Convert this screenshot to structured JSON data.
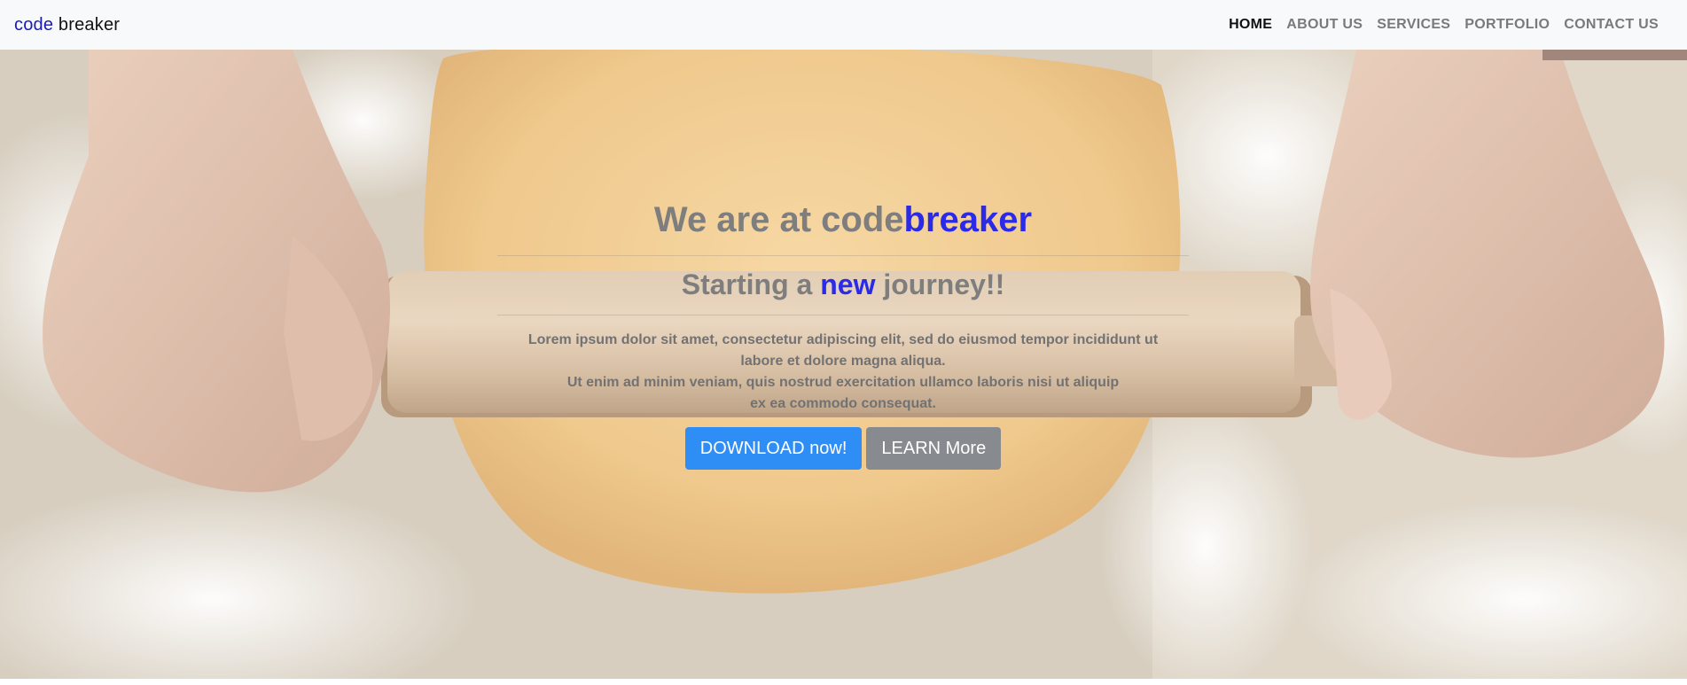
{
  "brand": {
    "part1": "code",
    "part2": " breaker"
  },
  "nav": {
    "items": [
      {
        "label": "HOME",
        "active": true
      },
      {
        "label": "ABOUT US",
        "active": false
      },
      {
        "label": "SERVICES",
        "active": false
      },
      {
        "label": "PORTFOLIO",
        "active": false
      },
      {
        "label": "CONTACT US",
        "active": false
      }
    ]
  },
  "hero": {
    "title_prefix": "We are at code",
    "title_accent": "breaker",
    "subtitle_prefix": "Starting a ",
    "subtitle_accent": "new",
    "subtitle_suffix": " journey!!",
    "paragraph_line1": "Lorem ipsum dolor sit amet, consectetur adipiscing elit, sed do eiusmod tempor incididunt ut",
    "paragraph_line2": "labore et dolore magna aliqua.",
    "paragraph_line3": "Ut enim ad minim veniam, quis nostrud exercitation ullamco laboris nisi ut aliquip",
    "paragraph_line4": "ex ea commodo consequat.",
    "download_button": "DOWNLOAD now!",
    "learn_button": "LEARN More"
  },
  "colors": {
    "brand_accent": "#1a1ab8",
    "title_accent": "#2a2ae8",
    "primary_button": "#2f8ef5",
    "secondary_button": "#878a8f",
    "navbar_bg": "#f8f9fa"
  },
  "background_image": "hands-rolling-dough-with-rolling-pin"
}
